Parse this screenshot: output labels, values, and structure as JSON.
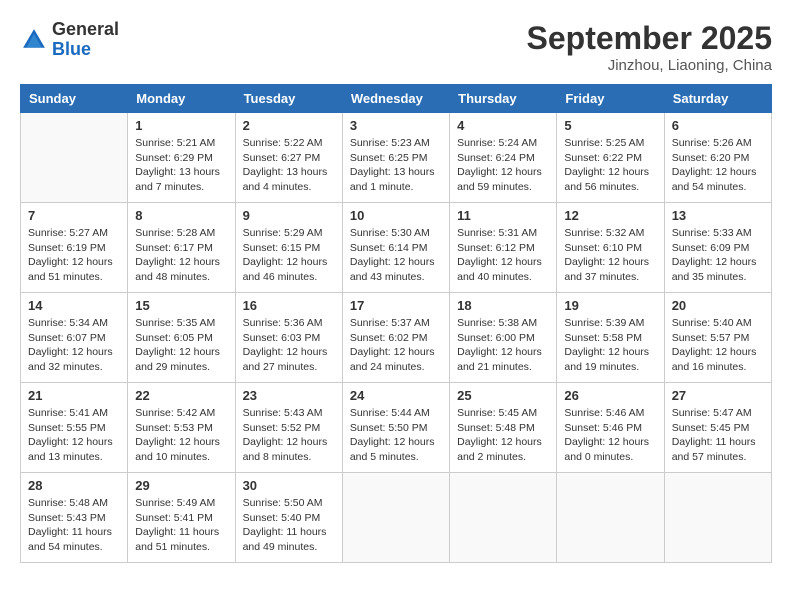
{
  "header": {
    "logo_general": "General",
    "logo_blue": "Blue",
    "month_title": "September 2025",
    "location": "Jinzhou, Liaoning, China"
  },
  "days_of_week": [
    "Sunday",
    "Monday",
    "Tuesday",
    "Wednesday",
    "Thursday",
    "Friday",
    "Saturday"
  ],
  "weeks": [
    [
      {
        "day": "",
        "info": ""
      },
      {
        "day": "1",
        "info": "Sunrise: 5:21 AM\nSunset: 6:29 PM\nDaylight: 13 hours\nand 7 minutes."
      },
      {
        "day": "2",
        "info": "Sunrise: 5:22 AM\nSunset: 6:27 PM\nDaylight: 13 hours\nand 4 minutes."
      },
      {
        "day": "3",
        "info": "Sunrise: 5:23 AM\nSunset: 6:25 PM\nDaylight: 13 hours\nand 1 minute."
      },
      {
        "day": "4",
        "info": "Sunrise: 5:24 AM\nSunset: 6:24 PM\nDaylight: 12 hours\nand 59 minutes."
      },
      {
        "day": "5",
        "info": "Sunrise: 5:25 AM\nSunset: 6:22 PM\nDaylight: 12 hours\nand 56 minutes."
      },
      {
        "day": "6",
        "info": "Sunrise: 5:26 AM\nSunset: 6:20 PM\nDaylight: 12 hours\nand 54 minutes."
      }
    ],
    [
      {
        "day": "7",
        "info": "Sunrise: 5:27 AM\nSunset: 6:19 PM\nDaylight: 12 hours\nand 51 minutes."
      },
      {
        "day": "8",
        "info": "Sunrise: 5:28 AM\nSunset: 6:17 PM\nDaylight: 12 hours\nand 48 minutes."
      },
      {
        "day": "9",
        "info": "Sunrise: 5:29 AM\nSunset: 6:15 PM\nDaylight: 12 hours\nand 46 minutes."
      },
      {
        "day": "10",
        "info": "Sunrise: 5:30 AM\nSunset: 6:14 PM\nDaylight: 12 hours\nand 43 minutes."
      },
      {
        "day": "11",
        "info": "Sunrise: 5:31 AM\nSunset: 6:12 PM\nDaylight: 12 hours\nand 40 minutes."
      },
      {
        "day": "12",
        "info": "Sunrise: 5:32 AM\nSunset: 6:10 PM\nDaylight: 12 hours\nand 37 minutes."
      },
      {
        "day": "13",
        "info": "Sunrise: 5:33 AM\nSunset: 6:09 PM\nDaylight: 12 hours\nand 35 minutes."
      }
    ],
    [
      {
        "day": "14",
        "info": "Sunrise: 5:34 AM\nSunset: 6:07 PM\nDaylight: 12 hours\nand 32 minutes."
      },
      {
        "day": "15",
        "info": "Sunrise: 5:35 AM\nSunset: 6:05 PM\nDaylight: 12 hours\nand 29 minutes."
      },
      {
        "day": "16",
        "info": "Sunrise: 5:36 AM\nSunset: 6:03 PM\nDaylight: 12 hours\nand 27 minutes."
      },
      {
        "day": "17",
        "info": "Sunrise: 5:37 AM\nSunset: 6:02 PM\nDaylight: 12 hours\nand 24 minutes."
      },
      {
        "day": "18",
        "info": "Sunrise: 5:38 AM\nSunset: 6:00 PM\nDaylight: 12 hours\nand 21 minutes."
      },
      {
        "day": "19",
        "info": "Sunrise: 5:39 AM\nSunset: 5:58 PM\nDaylight: 12 hours\nand 19 minutes."
      },
      {
        "day": "20",
        "info": "Sunrise: 5:40 AM\nSunset: 5:57 PM\nDaylight: 12 hours\nand 16 minutes."
      }
    ],
    [
      {
        "day": "21",
        "info": "Sunrise: 5:41 AM\nSunset: 5:55 PM\nDaylight: 12 hours\nand 13 minutes."
      },
      {
        "day": "22",
        "info": "Sunrise: 5:42 AM\nSunset: 5:53 PM\nDaylight: 12 hours\nand 10 minutes."
      },
      {
        "day": "23",
        "info": "Sunrise: 5:43 AM\nSunset: 5:52 PM\nDaylight: 12 hours\nand 8 minutes."
      },
      {
        "day": "24",
        "info": "Sunrise: 5:44 AM\nSunset: 5:50 PM\nDaylight: 12 hours\nand 5 minutes."
      },
      {
        "day": "25",
        "info": "Sunrise: 5:45 AM\nSunset: 5:48 PM\nDaylight: 12 hours\nand 2 minutes."
      },
      {
        "day": "26",
        "info": "Sunrise: 5:46 AM\nSunset: 5:46 PM\nDaylight: 12 hours\nand 0 minutes."
      },
      {
        "day": "27",
        "info": "Sunrise: 5:47 AM\nSunset: 5:45 PM\nDaylight: 11 hours\nand 57 minutes."
      }
    ],
    [
      {
        "day": "28",
        "info": "Sunrise: 5:48 AM\nSunset: 5:43 PM\nDaylight: 11 hours\nand 54 minutes."
      },
      {
        "day": "29",
        "info": "Sunrise: 5:49 AM\nSunset: 5:41 PM\nDaylight: 11 hours\nand 51 minutes."
      },
      {
        "day": "30",
        "info": "Sunrise: 5:50 AM\nSunset: 5:40 PM\nDaylight: 11 hours\nand 49 minutes."
      },
      {
        "day": "",
        "info": ""
      },
      {
        "day": "",
        "info": ""
      },
      {
        "day": "",
        "info": ""
      },
      {
        "day": "",
        "info": ""
      }
    ]
  ]
}
